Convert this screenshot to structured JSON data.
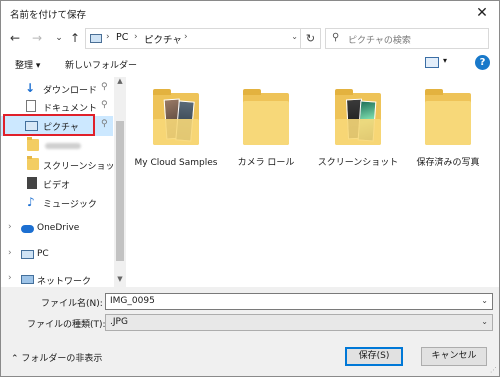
{
  "window": {
    "title": "名前を付けて保存",
    "close": "✕"
  },
  "nav": {
    "back": "←",
    "forward": "→",
    "recent": "⌄",
    "up": "↑",
    "breadcrumb": [
      "PC",
      "ピクチャ"
    ],
    "separator": "›",
    "refresh": "↻",
    "search_placeholder": "ピクチャの検索"
  },
  "toolbar": {
    "organize": "整理 ▾",
    "new_folder": "新しいフォルダー",
    "help": "?"
  },
  "navpane": {
    "items": [
      {
        "label": "ダウンロード",
        "pinned": true
      },
      {
        "label": "ドキュメント",
        "pinned": true
      },
      {
        "label": "ピクチャ",
        "pinned": true,
        "selected": true
      },
      {
        "label": "",
        "blurred": true
      },
      {
        "label": "スクリーンショット"
      },
      {
        "label": "ビデオ"
      },
      {
        "label": "ミュージック"
      },
      {
        "label": "OneDrive"
      },
      {
        "label": "PC"
      },
      {
        "label": "ネットワーク"
      }
    ]
  },
  "files": [
    {
      "name": "My Cloud Samples",
      "type": "photos-a"
    },
    {
      "name": "カメラ ロール",
      "type": "plain"
    },
    {
      "name": "スクリーンショット",
      "type": "photos-b"
    },
    {
      "name": "保存済みの写真",
      "type": "plain"
    }
  ],
  "form": {
    "filename_label": "ファイル名(N):",
    "filename_value": "IMG_0095",
    "filetype_label": "ファイルの種類(T):",
    "filetype_value": ".JPG"
  },
  "footer": {
    "hide_folders": "フォルダーの非表示",
    "save": "保存(S)",
    "cancel": "キャンセル"
  },
  "colors": {
    "selection": "#cce8ff",
    "highlight_border": "#e0202a",
    "folder": "#f7d879",
    "primary_border": "#0078d7"
  }
}
